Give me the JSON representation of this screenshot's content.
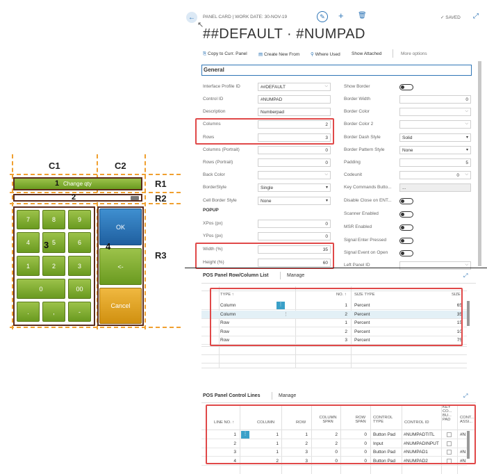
{
  "left_diagram": {
    "col_labels": [
      "C1",
      "C2"
    ],
    "row_labels": [
      "R1",
      "R2",
      "R3"
    ],
    "area_numbers": [
      "1",
      "2",
      "3",
      "4"
    ],
    "title_button": "Change qty",
    "keypad": [
      "7",
      "8",
      "9",
      "4",
      "5",
      "6",
      "1",
      "2",
      "3",
      "0",
      "00",
      ".",
      ",",
      "-"
    ],
    "side_buttons": [
      "OK",
      "<-",
      "Cancel"
    ]
  },
  "card": {
    "breadcrumb": "PANEL CARD | WORK DATE: 30-NOV-19",
    "title": "##DEFAULT · #NUMPAD",
    "saved": "SAVED",
    "actions": [
      "Copy to Curr. Panel",
      "Create New From",
      "Where Used",
      "Show Attached",
      "More options"
    ],
    "section": "General",
    "left_fields": [
      {
        "label": "Interface Profile ID",
        "value": "##DEFAULT"
      },
      {
        "label": "Control ID",
        "value": "#NUMPAD"
      },
      {
        "label": "Description",
        "value": "Numberpad"
      },
      {
        "label": "Columns",
        "value": "2"
      },
      {
        "label": "Rows",
        "value": "3"
      },
      {
        "label": "Columns (Portrait)",
        "value": "0"
      },
      {
        "label": "Rows (Portrait)",
        "value": "0"
      },
      {
        "label": "Back Color",
        "value": ""
      },
      {
        "label": "BorderStyle",
        "value": "Single"
      },
      {
        "label": "Cell Border Style",
        "value": "None"
      },
      {
        "label": "POPUP",
        "value": ""
      },
      {
        "label": "XPos (px)",
        "value": "0"
      },
      {
        "label": "YPos (px)",
        "value": "0"
      },
      {
        "label": "Width (%)",
        "value": "35"
      },
      {
        "label": "Height (%)",
        "value": "60"
      }
    ],
    "right_fields": [
      {
        "label": "Show Border",
        "value": ""
      },
      {
        "label": "Border Width",
        "value": "0"
      },
      {
        "label": "Border Color",
        "value": ""
      },
      {
        "label": "Border Color 2",
        "value": ""
      },
      {
        "label": "Border Dash Style",
        "value": "Solid"
      },
      {
        "label": "Border Pattern Style",
        "value": "None"
      },
      {
        "label": "Padding",
        "value": "5"
      },
      {
        "label": "Codeunit",
        "value": "0"
      },
      {
        "label": "Key Commands Butto...",
        "value": "..."
      },
      {
        "label": "Disable Close on ENT...",
        "value": ""
      },
      {
        "label": "Scanner Enabled",
        "value": ""
      },
      {
        "label": "MSR Enabled",
        "value": ""
      },
      {
        "label": "Signal Enter Pressed",
        "value": ""
      },
      {
        "label": "Signal Event on Open",
        "value": ""
      },
      {
        "label": "Left Panel ID",
        "value": ""
      }
    ]
  },
  "rowcol": {
    "title": "POS Panel Row/Column List",
    "manage": "Manage",
    "headers": [
      "TYPE ↑",
      "NO. ↑",
      "SIZE TYPE",
      "SIZE"
    ],
    "rows": [
      [
        "Column",
        "1",
        "Percent",
        "65"
      ],
      [
        "Column",
        "2",
        "Percent",
        "35"
      ],
      [
        "Row",
        "1",
        "Percent",
        "15"
      ],
      [
        "Row",
        "2",
        "Percent",
        "10"
      ],
      [
        "Row",
        "3",
        "Percent",
        "75"
      ]
    ]
  },
  "controls": {
    "title": "POS Panel Control Lines",
    "manage": "Manage",
    "headers": [
      "LINE NO. ↑",
      "COLUMN",
      "ROW",
      "COLUMN SPAN",
      "ROW SPAN",
      "CONTROL TYPE",
      "CONTROL ID",
      "KEY CO... BU... PAD",
      "CONT... ASSI..."
    ],
    "rows": [
      [
        "1",
        "1",
        "1",
        "2",
        "0",
        "Button Pad",
        "#NUMPADTITL",
        "#N"
      ],
      [
        "2",
        "1",
        "2",
        "2",
        "0",
        "Input",
        "#NUMPADINPUT",
        ""
      ],
      [
        "3",
        "1",
        "3",
        "0",
        "0",
        "Button Pad",
        "#NUMPAD1",
        "#N"
      ],
      [
        "4",
        "2",
        "3",
        "0",
        "0",
        "Button Pad",
        "#NUMPAD2",
        "#N"
      ]
    ]
  },
  "colors": {
    "accent": "#2e75b6",
    "green": "#7cab2e",
    "blue": "#2a6fb0",
    "orange": "#e0a020",
    "red": "#e04848",
    "dash": "#f0a030"
  }
}
